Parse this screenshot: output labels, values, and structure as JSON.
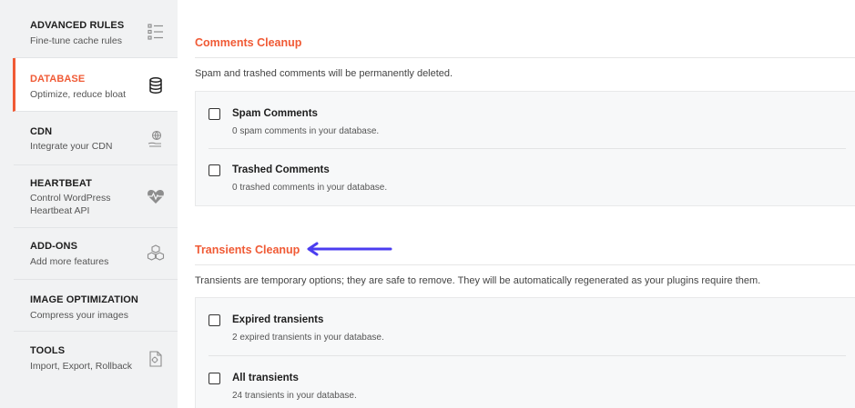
{
  "sidebar": {
    "items": [
      {
        "title": "ADVANCED RULES",
        "subtitle": "Fine-tune cache rules",
        "icon": "list-icon",
        "active": false
      },
      {
        "title": "DATABASE",
        "subtitle": "Optimize, reduce bloat",
        "icon": "database-icon",
        "active": true
      },
      {
        "title": "CDN",
        "subtitle": "Integrate your CDN",
        "icon": "cdn-icon",
        "active": false
      },
      {
        "title": "HEARTBEAT",
        "subtitle": "Control WordPress Heartbeat API",
        "icon": "heartbeat-icon",
        "active": false
      },
      {
        "title": "ADD-ONS",
        "subtitle": "Add more features",
        "icon": "addons-icon",
        "active": false
      },
      {
        "title": "IMAGE OPTIMIZATION",
        "subtitle": "Compress your images",
        "icon": "",
        "active": false
      },
      {
        "title": "TOOLS",
        "subtitle": "Import, Export, Rollback",
        "icon": "tools-icon",
        "active": false
      }
    ]
  },
  "comments": {
    "title": "Comments Cleanup",
    "description": "Spam and trashed comments will be permanently deleted.",
    "options": [
      {
        "label": "Spam Comments",
        "detail": "0 spam comments in your database.",
        "checked": false
      },
      {
        "label": "Trashed Comments",
        "detail": "0 trashed comments in your database.",
        "checked": false
      }
    ]
  },
  "transients": {
    "title": "Transients Cleanup",
    "description": "Transients are temporary options; they are safe to remove. They will be automatically regenerated as your plugins require them.",
    "options": [
      {
        "label": "Expired transients",
        "detail": "2 expired transients in your database.",
        "checked": false
      },
      {
        "label": "All transients",
        "detail": "24 transients in your database.",
        "checked": false
      }
    ]
  },
  "colors": {
    "accent": "#f05a35",
    "arrow": "#4b3df0",
    "sidebar_bg": "#f1f2f3",
    "panel_bg": "#f7f8f9"
  }
}
